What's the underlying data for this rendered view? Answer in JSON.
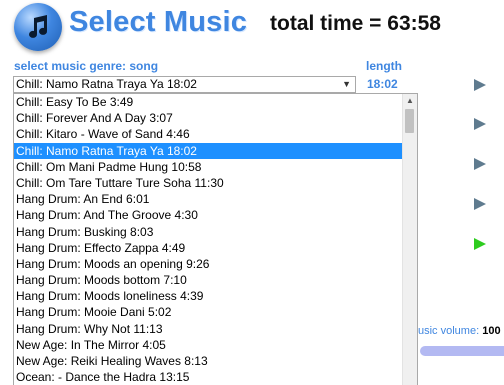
{
  "header": {
    "title": "Select Music",
    "total_time": "total time = 63:58"
  },
  "labels": {
    "genre_song": "select music genre: song",
    "length": "length"
  },
  "select": {
    "value": "Chill: Namo Ratna Traya Ya 18:02",
    "length_value": "18:02"
  },
  "songs": [
    "Chill: Easy To Be 3:49",
    "Chill: Forever And A Day 3:07",
    "Chill: Kitaro - Wave of Sand 4:46",
    "Chill: Namo Ratna Traya Ya 18:02",
    "Chill: Om Mani Padme Hung 10:58",
    "Chill: Om Tare Tuttare Ture Soha 11:30",
    "Hang Drum: An End 6:01",
    "Hang Drum: And The Groove 4:30",
    "Hang Drum: Busking 8:03",
    "Hang Drum: Effecto Zappa 4:49",
    "Hang Drum: Moods an opening 9:26",
    "Hang Drum: Moods bottom 7:10",
    "Hang Drum: Moods loneliness 4:39",
    "Hang Drum: Mooie Dani 5:02",
    "Hang Drum: Why Not 11:13",
    "New Age: In The Mirror 4:05",
    "New Age: Reiki Healing Waves 8:13",
    "Ocean: - Dance the Hadra 13:15"
  ],
  "selected_index": 3,
  "volume": {
    "label": "usic volume:",
    "value": "100"
  },
  "colors": {
    "accent": "#3f86e0",
    "selection": "#1e90ff",
    "play_grey": "#5f7b8f",
    "play_green": "#2ecc1f",
    "volume_track": "#b3b9f2"
  },
  "icons": {
    "logo": "music-note-icon",
    "dropdown": "chevron-down-icon",
    "play": "play-icon"
  }
}
